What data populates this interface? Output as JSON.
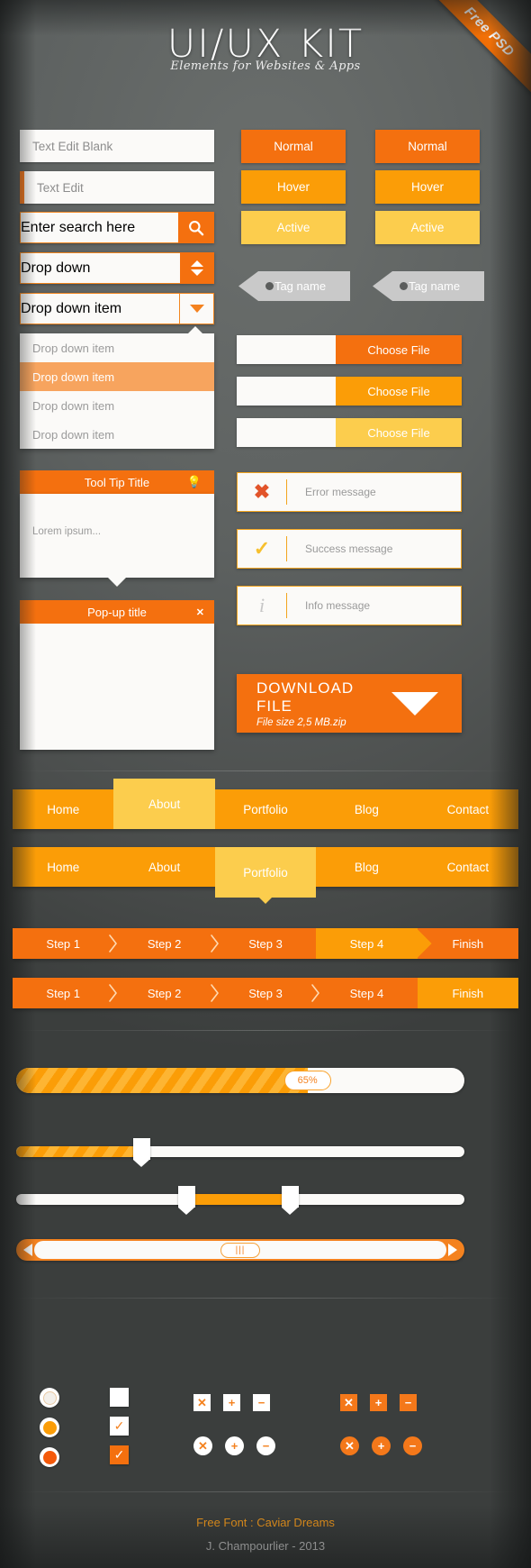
{
  "header": {
    "title": "UI/UX KIT",
    "subtitle": "Elements for Websites & Apps",
    "ribbon": "Free PSD"
  },
  "colors": {
    "normal": "#f4700f",
    "hover": "#fb9d07",
    "active": "#fccd4d",
    "background": "#5e6260",
    "tag": "#c9c9c9",
    "error": "#e2542a",
    "success": "#f7c02e",
    "info": "#cfcfcf"
  },
  "form": {
    "text_edit_blank": "Text Edit Blank",
    "text_edit": "Text Edit",
    "search_placeholder": "Enter search here",
    "search_icon": "search-icon",
    "dropdown_value": "Drop down",
    "dropdown_stepper_icon": "stepper-updown-icon",
    "dropdown_item_value": "Drop down item",
    "dropdown_caret_icon": "chevron-down-icon",
    "dropdown_list": [
      {
        "label": "Drop down item",
        "selected": false
      },
      {
        "label": "Drop down item",
        "selected": true
      },
      {
        "label": "Drop down item",
        "selected": false
      },
      {
        "label": "Drop down item",
        "selected": false
      }
    ]
  },
  "tooltip": {
    "title": "Tool Tip Title",
    "icon": "lightbulb-icon",
    "body": "Lorem ipsum..."
  },
  "popup": {
    "title": "Pop-up title",
    "close_icon": "close-icon"
  },
  "buttons": {
    "column_left": [
      {
        "label": "Normal",
        "state": "normal"
      },
      {
        "label": "Hover",
        "state": "hover"
      },
      {
        "label": "Active",
        "state": "active"
      }
    ],
    "column_right": [
      {
        "label": "Normal",
        "state": "normal"
      },
      {
        "label": "Hover",
        "state": "hover"
      },
      {
        "label": "Active",
        "state": "active"
      }
    ]
  },
  "tags": [
    {
      "label": "Tag name"
    },
    {
      "label": "Tag name"
    }
  ],
  "file_inputs": [
    {
      "button_label": "Choose File",
      "state": "normal"
    },
    {
      "button_label": "Choose File",
      "state": "hover"
    },
    {
      "button_label": "Choose File",
      "state": "active"
    }
  ],
  "messages": [
    {
      "type": "error",
      "icon": "cross-icon",
      "text": "Error message"
    },
    {
      "type": "success",
      "icon": "check-icon",
      "text": "Success message"
    },
    {
      "type": "info",
      "icon": "info-icon",
      "text": "Info message"
    }
  ],
  "download": {
    "title": "DOWNLOAD FILE",
    "subtitle": "File size 2,5 MB.zip",
    "icon": "download-triangle-icon"
  },
  "nav_primary": {
    "items": [
      {
        "label": "Home",
        "selected": false
      },
      {
        "label": "About",
        "selected": true
      },
      {
        "label": "Portfolio",
        "selected": false
      },
      {
        "label": "Blog",
        "selected": false
      },
      {
        "label": "Contact",
        "selected": false
      }
    ]
  },
  "nav_secondary": {
    "items": [
      {
        "label": "Home",
        "selected": false
      },
      {
        "label": "About",
        "selected": false
      },
      {
        "label": "Portfolio",
        "selected": true
      },
      {
        "label": "Blog",
        "selected": false
      },
      {
        "label": "Contact",
        "selected": false
      }
    ]
  },
  "steps_primary": {
    "items": [
      {
        "label": "Step 1",
        "highlighted": false
      },
      {
        "label": "Step 2",
        "highlighted": false
      },
      {
        "label": "Step 3",
        "highlighted": false
      },
      {
        "label": "Step 4",
        "highlighted": true
      },
      {
        "label": "Finish",
        "highlighted": false
      }
    ]
  },
  "steps_secondary": {
    "items": [
      {
        "label": "Step 1",
        "highlighted": false
      },
      {
        "label": "Step 2",
        "highlighted": false
      },
      {
        "label": "Step 3",
        "highlighted": false
      },
      {
        "label": "Step 4",
        "highlighted": false
      },
      {
        "label": "Finish",
        "highlighted": true
      }
    ]
  },
  "progress": {
    "value_label": "65%",
    "value": 65
  },
  "slider_single": {
    "value": 28
  },
  "slider_range": {
    "from": 38,
    "to": 61
  },
  "scrollbar": {
    "left_arrow_icon": "arrow-left-icon",
    "right_arrow_icon": "arrow-right-icon",
    "grip_icon": "grip-lines-icon",
    "grip_label": "|||",
    "position": 50
  },
  "controls": {
    "radios": [
      {
        "state": "empty"
      },
      {
        "state": "hover"
      },
      {
        "state": "selected"
      }
    ],
    "checkboxes": [
      {
        "state": "empty",
        "icon": ""
      },
      {
        "state": "checked-light",
        "icon": "check-icon"
      },
      {
        "state": "checked-filled",
        "icon": "check-icon"
      }
    ],
    "icon_buttons_light": [
      {
        "icon": "close-icon",
        "glyph": "✕",
        "shape": "square"
      },
      {
        "icon": "plus-icon",
        "glyph": "➕",
        "shape": "square"
      },
      {
        "icon": "minus-icon",
        "glyph": "➖",
        "shape": "square"
      },
      {
        "icon": "close-icon",
        "glyph": "✕",
        "shape": "circle"
      },
      {
        "icon": "plus-icon",
        "glyph": "➕",
        "shape": "circle"
      },
      {
        "icon": "minus-icon",
        "glyph": "➖",
        "shape": "circle"
      }
    ],
    "icon_buttons_dark": [
      {
        "icon": "close-icon",
        "glyph": "✕",
        "shape": "square"
      },
      {
        "icon": "plus-icon",
        "glyph": "➕",
        "shape": "square"
      },
      {
        "icon": "minus-icon",
        "glyph": "➖",
        "shape": "square"
      },
      {
        "icon": "close-icon",
        "glyph": "✕",
        "shape": "circle"
      },
      {
        "icon": "plus-icon",
        "glyph": "➕",
        "shape": "circle"
      },
      {
        "icon": "minus-icon",
        "glyph": "➖",
        "shape": "circle"
      }
    ]
  },
  "footer": {
    "font_line": "Free Font : Caviar Dreams",
    "author_line": "J. Champourlier - 2013"
  }
}
